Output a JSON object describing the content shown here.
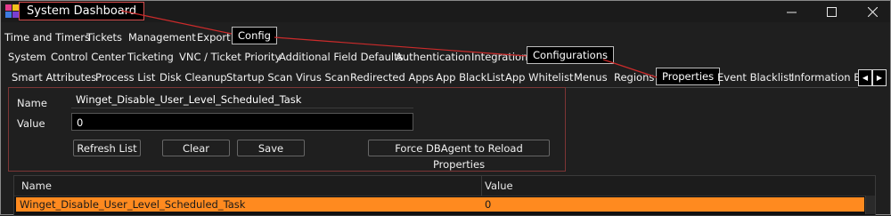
{
  "window": {
    "title": "System Dashboard",
    "icon": "app-logo-icon",
    "controls": [
      "minimize-icon",
      "maximize-icon",
      "close-icon"
    ]
  },
  "menu": {
    "items": [
      "Time and Timers",
      "Tickets",
      "Management",
      "Export"
    ],
    "callout": "Config"
  },
  "config_tabs": {
    "items": [
      "System",
      "Control Center",
      "Ticketing",
      "VNC / Ticket Priority",
      "Additional Field Defaults",
      "Authentication",
      "Integration"
    ],
    "callout": "Configurations"
  },
  "config_subtabs": {
    "items_before": [
      "Smart Attributes",
      "Process List",
      "Disk Cleanup",
      "Startup Scan",
      "Virus Scan",
      "Redirected Apps",
      "App BlackList",
      "App Whitelist",
      "Menus",
      "Regions"
    ],
    "callout": "Properties",
    "items_after": [
      "Event Blacklist",
      "Information Ba"
    ],
    "scroll_left": "◀",
    "scroll_right": "▶"
  },
  "form": {
    "name_label": "Name",
    "name_value": "Winget_Disable_User_Level_Scheduled_Task",
    "value_label": "Value",
    "value_value": "0",
    "buttons": {
      "refresh": "Refresh List",
      "clear": "Clear",
      "save": "Save",
      "force": "Force DBAgent to Reload Properties"
    }
  },
  "grid": {
    "columns": [
      "Name",
      "Value"
    ],
    "rows": [
      {
        "name": "Winget_Disable_User_Level_Scheduled_Task",
        "value": "0",
        "selected": true
      }
    ]
  },
  "colors": {
    "background": "#1f1f1f",
    "selection": "#ff8a1f",
    "callout_border": "#d24c4c",
    "connector": "#cc2b2b"
  }
}
